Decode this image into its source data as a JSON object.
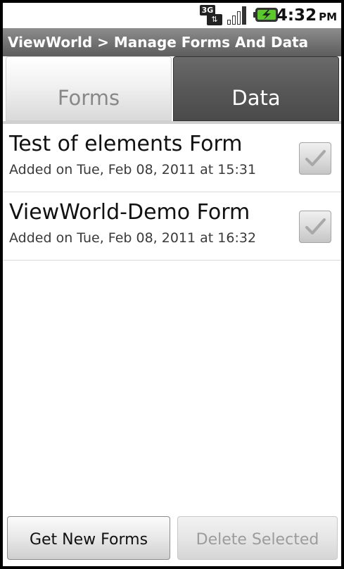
{
  "status_bar": {
    "network": "3G",
    "network_icon": "3g-data-icon",
    "signal_icon": "signal-strength-icon",
    "battery_icon": "battery-charging-icon",
    "time": "4:32",
    "ampm": "PM"
  },
  "title_bar": {
    "title": "ViewWorld > Manage Forms And Data"
  },
  "tabs": [
    {
      "label": "Forms",
      "selected": false
    },
    {
      "label": "Data",
      "selected": true
    }
  ],
  "forms": [
    {
      "title": "Test of elements Form",
      "subtitle": "Added on Tue, Feb 08, 2011 at 15:31",
      "checked": true
    },
    {
      "title": "ViewWorld-Demo Form",
      "subtitle": "Added on Tue, Feb 08, 2011 at 16:32",
      "checked": true
    }
  ],
  "buttons": {
    "get_new_forms": "Get New Forms",
    "delete_selected": "Delete Selected"
  },
  "colors": {
    "title_bar": "#6f6f6f",
    "selected_tab": "#585858",
    "unselected_tab": "#f1f1f1",
    "checkmark": "#a8a8a8"
  }
}
